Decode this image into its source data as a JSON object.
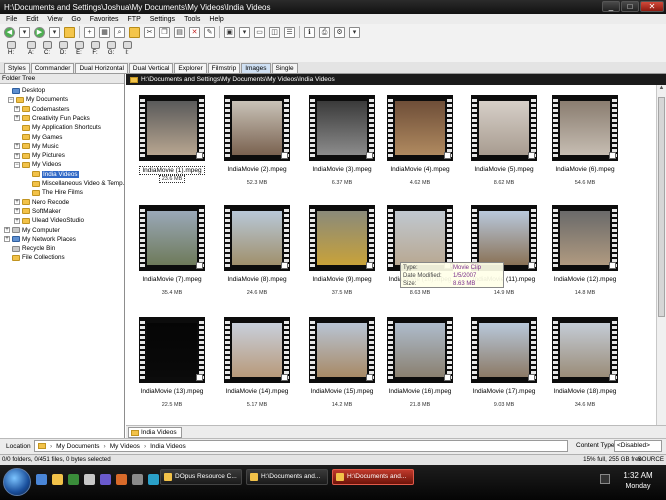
{
  "window": {
    "title": "H:\\Documents and Settings\\Joshua\\My Documents\\My Videos\\India Videos",
    "buttons": {
      "minimize": "_",
      "maximize": "□",
      "close": "✕"
    }
  },
  "menu": [
    "File",
    "Edit",
    "View",
    "Go",
    "Favorites",
    "FTP",
    "Settings",
    "Tools",
    "Help"
  ],
  "drives": [
    "H:",
    "A:",
    "C:",
    "D:",
    "E:",
    "F:",
    "G:",
    "I:"
  ],
  "style_tabs": [
    "Styles",
    "Commander",
    "Dual Horizontal",
    "Dual Vertical",
    "Explorer",
    "Filmstrip",
    "Images",
    "Single"
  ],
  "active_style_tab": "Images",
  "tree": {
    "title": "Folder Tree",
    "nodes": [
      {
        "label": "Desktop",
        "expander": "",
        "kind": "blue"
      },
      {
        "label": "My Documents",
        "expander": "−",
        "kind": "folder"
      },
      {
        "label": "Codemasters",
        "expander": "+",
        "kind": "folder"
      },
      {
        "label": "Creativity Fun Packs",
        "expander": "+",
        "kind": "folder"
      },
      {
        "label": "My Application Shortcuts",
        "expander": "",
        "kind": "folder"
      },
      {
        "label": "My Games",
        "expander": "",
        "kind": "folder"
      },
      {
        "label": "My Music",
        "expander": "+",
        "kind": "folder"
      },
      {
        "label": "My Pictures",
        "expander": "+",
        "kind": "folder"
      },
      {
        "label": "My Videos",
        "expander": "−",
        "kind": "folder"
      },
      {
        "label": "India Videos",
        "expander": "",
        "kind": "folder"
      },
      {
        "label": "Miscellaneous Video & Temp. P",
        "expander": "",
        "kind": "folder"
      },
      {
        "label": "The Hire Films",
        "expander": "",
        "kind": "folder"
      },
      {
        "label": "Nero Recode",
        "expander": "+",
        "kind": "folder"
      },
      {
        "label": "SoftMaker",
        "expander": "+",
        "kind": "folder"
      },
      {
        "label": "Ulead VideoStudio",
        "expander": "+",
        "kind": "folder"
      },
      {
        "label": "My Computer",
        "expander": "+",
        "kind": "gray"
      },
      {
        "label": "My Network Places",
        "expander": "+",
        "kind": "blue"
      },
      {
        "label": "Recycle Bin",
        "expander": "",
        "kind": "gray"
      },
      {
        "label": "File Collections",
        "expander": "",
        "kind": "folder"
      }
    ]
  },
  "path_header": "H:\\Documents and Settings\\My Documents\\My Videos\\India Videos",
  "files": [
    {
      "name": "IndiaMovie (1).mpeg",
      "size": "23.6 MB",
      "colors": [
        "#5a5a5a",
        "#b8a690"
      ]
    },
    {
      "name": "IndiaMovie (2).mpeg",
      "size": "52.3 MB",
      "colors": [
        "#c9c3b8",
        "#7a6250"
      ]
    },
    {
      "name": "IndiaMovie (3).mpeg",
      "size": "6.37 MB",
      "colors": [
        "#3a3a3a",
        "#8c8c8c"
      ]
    },
    {
      "name": "IndiaMovie (4).mpeg",
      "size": "4.62 MB",
      "colors": [
        "#6e4e38",
        "#b08a60"
      ]
    },
    {
      "name": "IndiaMovie (5).mpeg",
      "size": "8.62 MB",
      "colors": [
        "#d6cfc8",
        "#a89c90"
      ]
    },
    {
      "name": "IndiaMovie (6).mpeg",
      "size": "54.6 MB",
      "colors": [
        "#8a7d70",
        "#c6bdb2"
      ]
    },
    {
      "name": "IndiaMovie (7).mpeg",
      "size": "35.4 MB",
      "colors": [
        "#9aa8b8",
        "#6e7a5a"
      ]
    },
    {
      "name": "IndiaMovie (8).mpeg",
      "size": "24.6 MB",
      "colors": [
        "#b8c8d8",
        "#a0906c"
      ]
    },
    {
      "name": "IndiaMovie (9).mpeg",
      "size": "37.5 MB",
      "colors": [
        "#8a8a7a",
        "#c8a23a"
      ]
    },
    {
      "name": "IndiaMovie (10).mpeg",
      "size": "8.63 MB",
      "colors": [
        "#c0c8d0",
        "#b8a892"
      ]
    },
    {
      "name": "IndiaMovie (11).mpeg",
      "size": "14.9 MB",
      "colors": [
        "#b8c8dc",
        "#8a7256"
      ]
    },
    {
      "name": "IndiaMovie (12).mpeg",
      "size": "14.8 MB",
      "colors": [
        "#6a6a6a",
        "#b09a80"
      ]
    },
    {
      "name": "IndiaMovie (13).mpeg",
      "size": "22.5 MB",
      "colors": [
        "#050505",
        "#0a0a0a"
      ]
    },
    {
      "name": "IndiaMovie (14).mpeg",
      "size": "5.17 MB",
      "colors": [
        "#c8d0dc",
        "#b89a7a"
      ]
    },
    {
      "name": "IndiaMovie (15).mpeg",
      "size": "14.2 MB",
      "colors": [
        "#b8c4d4",
        "#a88a66"
      ]
    },
    {
      "name": "IndiaMovie (16).mpeg",
      "size": "21.8 MB",
      "colors": [
        "#aebccc",
        "#8a8070"
      ]
    },
    {
      "name": "IndiaMovie (17).mpeg",
      "size": "9.03 MB",
      "colors": [
        "#b8c8da",
        "#8c7a66"
      ]
    },
    {
      "name": "IndiaMovie (18).mpeg",
      "size": "34.6 MB",
      "colors": [
        "#c4ccd6",
        "#9a8c78"
      ]
    }
  ],
  "tooltip": {
    "rows": [
      {
        "key": "Type:",
        "value": "Movie Clip"
      },
      {
        "key": "Date Modified:",
        "value": "1/5/2007"
      },
      {
        "key": "Size:",
        "value": "8.63 MB"
      }
    ]
  },
  "folder_tab": "India Videos",
  "location": {
    "label": "Location",
    "parts": [
      "My Documents",
      "My Videos",
      "India Videos"
    ],
    "separator": "›",
    "content_type_label": "Content Type",
    "content_type_value": "<Disabled>"
  },
  "status": {
    "left": "0/0 folders, 0/451 files, 0 bytes selected",
    "right": "15% full, 255 GB free",
    "source": "SOURCE"
  },
  "taskbar": {
    "buttons": [
      {
        "label": "DOpus Resource C...",
        "active": false
      },
      {
        "label": "H:\\Documents and...",
        "active": false
      },
      {
        "label": "H:\\Documents and...",
        "active": true
      }
    ],
    "time": "1:32 AM",
    "day": "Monday"
  }
}
